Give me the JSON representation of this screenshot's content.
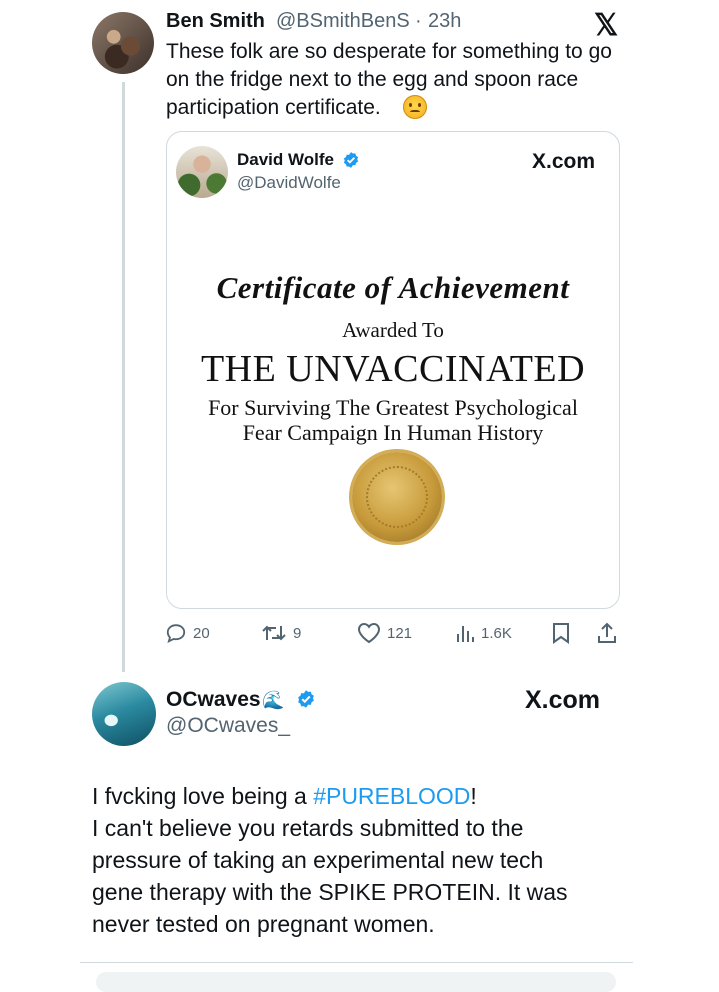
{
  "tweet": {
    "author_name": "Ben Smith",
    "author_handle": "@BSmithBenS",
    "separator": "·",
    "time": "23h",
    "platform_logo": "𝕏",
    "lines": [
      "These folk are so desperate for something to go",
      "on the fridge next to the egg and spoon race",
      "participation certificate."
    ],
    "emoji": "smirking-face-emoji"
  },
  "quote": {
    "author_name": "David Wolfe",
    "author_handle": "@DavidWolfe",
    "source": "X.com",
    "certificate": {
      "title": "Certificate of Achievement",
      "awarded": "Awarded To",
      "recipient": "THE UNVACCINATED",
      "line1": "For Surviving The Greatest Psychological",
      "line2": "Fear Campaign In Human History"
    }
  },
  "actions": {
    "replies": "20",
    "retweets": "9",
    "likes": "121",
    "views": "1.6K"
  },
  "reply": {
    "author_name": "OCwaves",
    "author_emoji": "🌊",
    "author_handle": "@OCwaves_",
    "source": "X.com",
    "line1_pre": "I fvcking love being a ",
    "hashtag": "#PUREBLOOD",
    "line1_post": "!",
    "lines": [
      "I can't believe you retards submitted to the",
      "pressure of taking an experimental new tech",
      "gene therapy with the SPIKE PROTEIN. It was",
      "never tested on pregnant women."
    ]
  },
  "colors": {
    "link": "#1d9bf0",
    "verified": "#1d9bf0",
    "muted": "#536471",
    "border": "#cfd9de"
  }
}
